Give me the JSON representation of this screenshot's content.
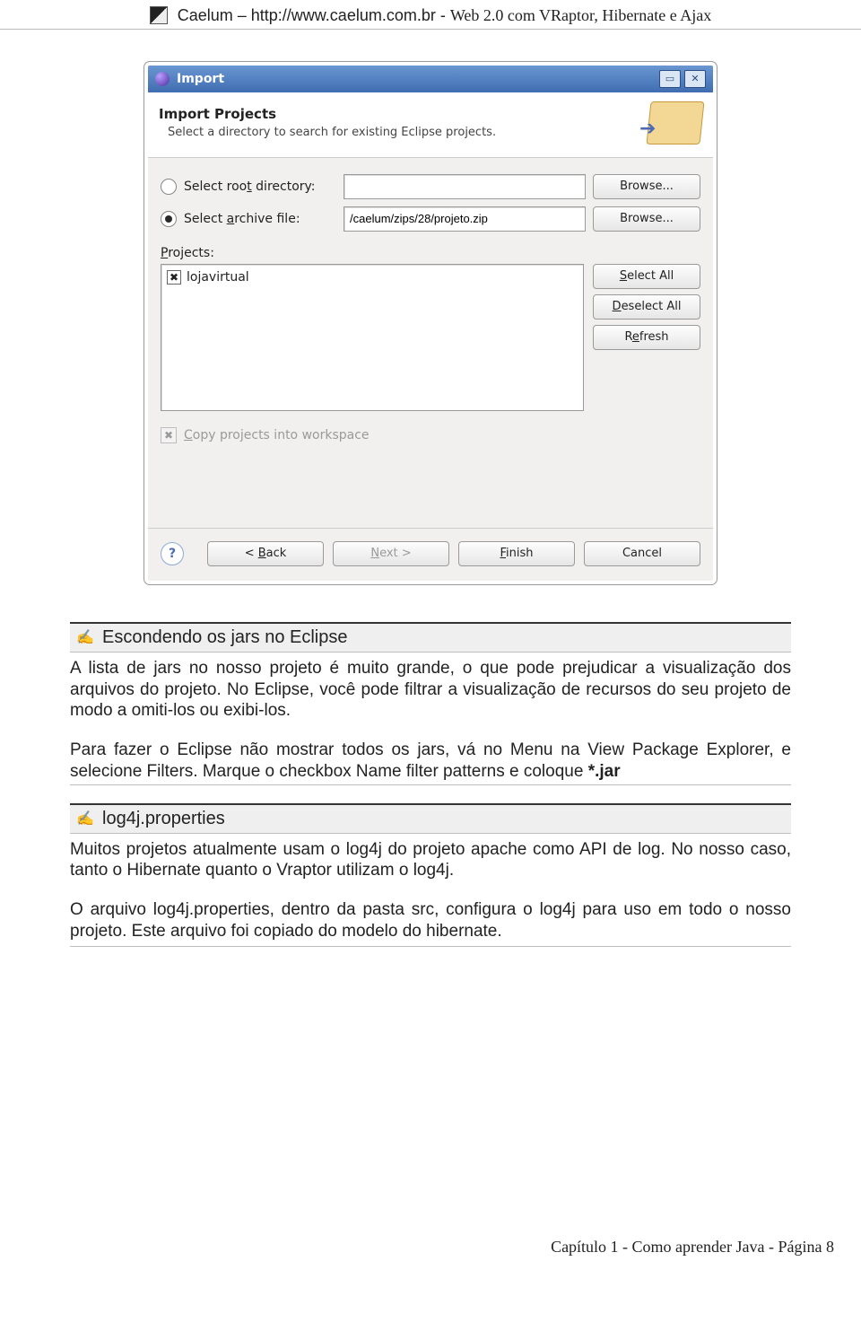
{
  "header": {
    "prefix": "Caelum – http://www.caelum.com.br - ",
    "title_serif": "Web 2.0 com VRaptor, Hibernate e Ajax"
  },
  "wizard": {
    "title": "Import",
    "banner_heading": "Import Projects",
    "banner_sub": "Select a directory to search for existing Eclipse projects.",
    "root_label_pre": "Select roo",
    "root_label_u": "t",
    "root_label_post": " directory:",
    "root_value": "",
    "archive_label_pre": "Select ",
    "archive_label_u": "a",
    "archive_label_post": "rchive file:",
    "archive_value": "/caelum/zips/28/projeto.zip",
    "browse": "Browse...",
    "projects_label_u": "P",
    "projects_label_post": "rojects:",
    "project_item": "lojavirtual",
    "select_all_u": "S",
    "select_all_post": "elect All",
    "deselect_all_u": "D",
    "deselect_all_post": "eselect All",
    "refresh_u": "e",
    "refresh_pre": "R",
    "refresh_post": "fresh",
    "copy_label_u": "C",
    "copy_label_post": "opy projects into workspace",
    "back_pre": "< ",
    "back_u": "B",
    "back_post": "ack",
    "next_u": "N",
    "next_post": "ext >",
    "finish_u": "F",
    "finish_post": "inish",
    "cancel": "Cancel"
  },
  "article": {
    "note1_title": "Escondendo os jars no Eclipse",
    "note1_p1": "A lista de jars no nosso projeto é muito grande, o que pode prejudicar a visualização dos arquivos do projeto. No Eclipse, você pode filtrar a visualização de recursos do seu projeto de modo a omiti-los ou exibi-los.",
    "note1_p2_a": "Para fazer o Eclipse não mostrar todos os jars, vá no Menu na View Package Explorer, e selecione Filters. Marque o checkbox Name filter patterns e coloque ",
    "note1_p2_b": "*.jar",
    "note2_title": "log4j.properties",
    "note2_p1": "Muitos projetos atualmente usam o log4j do projeto apache como API de log. No nosso caso, tanto o Hibernate quanto o Vraptor utilizam o log4j.",
    "note2_p2": "O arquivo log4j.properties, dentro da pasta src, configura o log4j para uso em todo o nosso projeto. Este arquivo foi copiado do modelo do hibernate."
  },
  "footer": "Capítulo 1 - Como aprender Java - Página 8"
}
